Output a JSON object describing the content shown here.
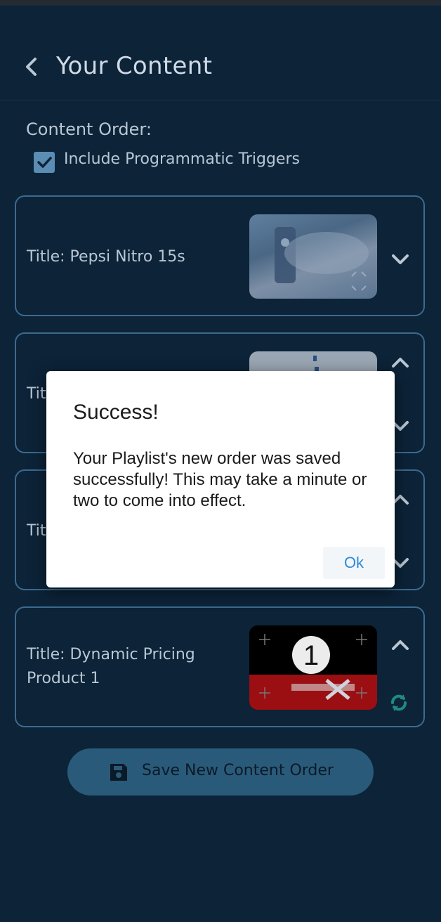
{
  "header": {
    "title": "Your Content",
    "back_icon": "chevron-left-icon"
  },
  "content_order": {
    "label": "Content Order:",
    "include_triggers": {
      "label": "Include Programmatic Triggers",
      "checked": true
    }
  },
  "cards": [
    {
      "title": "Title: Pepsi   Nitro 15s",
      "thumb": "pepsi-can-image",
      "chevrons": [
        "chevron-down-icon"
      ]
    },
    {
      "title": "Tit",
      "thumb": "blue-product-image",
      "chevrons": [
        "chevron-up-icon",
        "chevron-down-icon"
      ]
    },
    {
      "title": "Tit",
      "thumb": "hidden-image",
      "chevrons": [
        "chevron-up-icon",
        "chevron-down-icon"
      ]
    },
    {
      "title": "Title: Dynamic Pricing\nProduct 1",
      "thumb": "infinity-x-price-image",
      "thumb_number": "1",
      "chevrons": [
        "chevron-up-icon"
      ],
      "extra_icon": "refresh-icon"
    }
  ],
  "save_button": {
    "label": "Save New Content Order",
    "icon": "floppy-disk-icon"
  },
  "dialog": {
    "title": "Success!",
    "message": "Your Playlist's new order was saved successfully! This may take a minute or two to come into effect.",
    "ok_label": "Ok"
  },
  "colors": {
    "background": "#0c2338",
    "card_border": "#3d6a8f",
    "text": "#b9c7d4",
    "accent": "#2e8ad8",
    "button_bg": "#2a5a7a",
    "refresh_icon": "#1f8a84"
  }
}
